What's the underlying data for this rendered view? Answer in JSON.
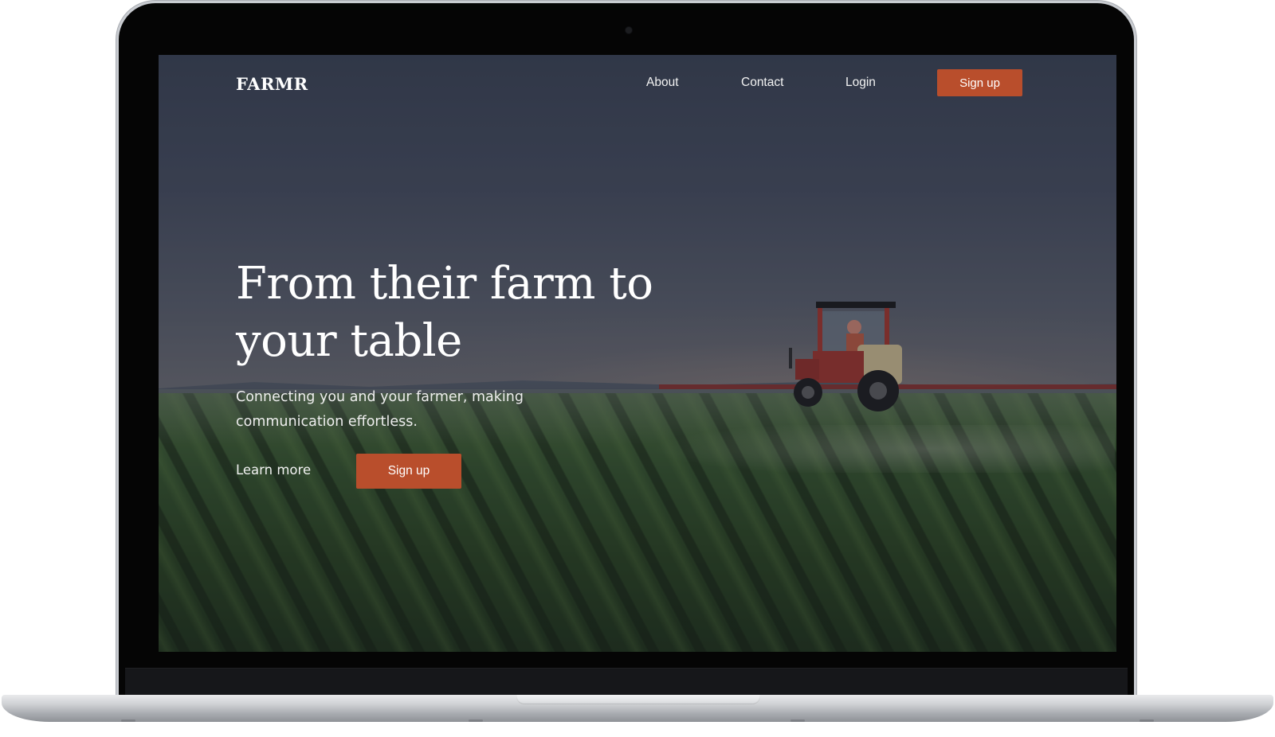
{
  "nav": {
    "logo": "FARMR",
    "links": [
      "About",
      "Contact",
      "Login"
    ],
    "signup_label": "Sign up"
  },
  "hero": {
    "title": "From their farm to your table",
    "subtitle": "Connecting you and your farmer, making communication effortless.",
    "learn_more_label": "Learn more",
    "signup_label": "Sign up"
  },
  "colors": {
    "accent": "#b94e2c",
    "overlay": "#2b3140",
    "text": "#ffffff"
  },
  "icons": {
    "camera": "camera-dot-icon"
  }
}
